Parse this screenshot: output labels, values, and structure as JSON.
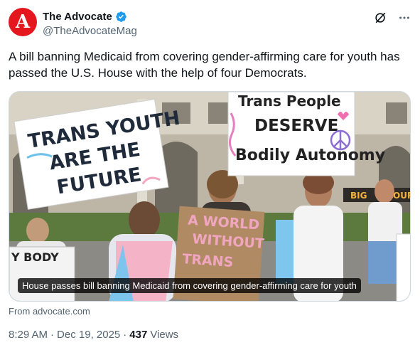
{
  "header": {
    "avatar_letter": "A",
    "display_name": "The Advocate",
    "handle": "@TheAdvocateMag",
    "icons": [
      "verified-badge-icon",
      "grok-icon",
      "more-icon"
    ]
  },
  "tweet": {
    "text": "A bill banning Medicaid from covering gender-affirming care for youth has passed the U.S. House with the help of four Democrats."
  },
  "card": {
    "caption": "House passes bill banning Medicaid from covering gender-affirming care for youth",
    "source": "From advocate.com",
    "signs": {
      "left": [
        "TRANS YOUTH",
        "ARE THE",
        "FUTURE"
      ],
      "right": [
        "Trans People",
        "DESERVE",
        "Bodily Autonomy"
      ],
      "center": [
        "A WORLD",
        "WITHOUT",
        "TRANS"
      ],
      "far_left": "Y BODY",
      "bg_banner": "BIG",
      "bg_banner2": "OUR"
    }
  },
  "meta": {
    "time": "8:29 AM",
    "date": "Dec 19, 2025",
    "separator": "·",
    "views_count": "437",
    "views_label": "Views"
  },
  "colors": {
    "brand_red": "#e4171f",
    "verified_blue": "#1d9bf0",
    "muted_text": "#536471"
  }
}
